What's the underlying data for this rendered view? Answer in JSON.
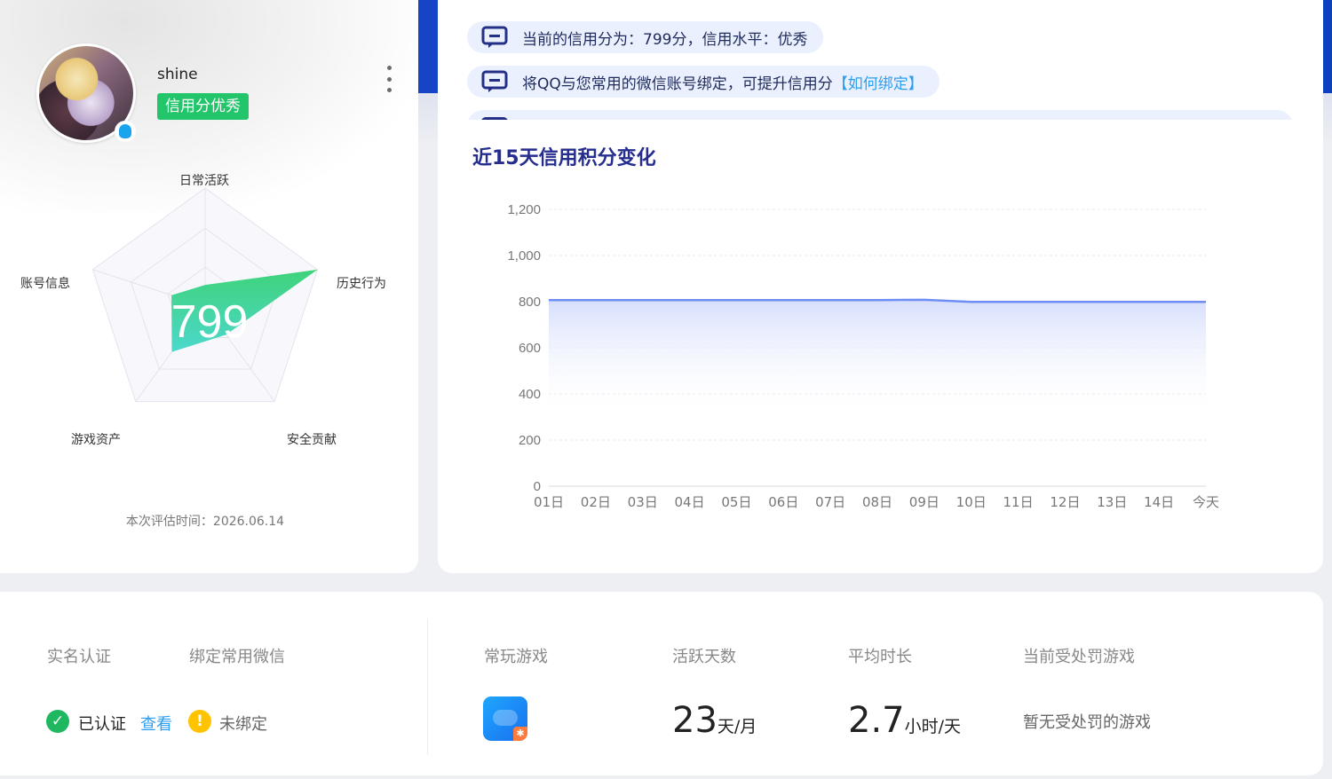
{
  "profile": {
    "username": "shine",
    "credit_tag": "信用分优秀",
    "score": "799",
    "eval_time": "本次评估时间：2026.06.14",
    "radar_labels": {
      "daily": "日常活跃",
      "history": "历史行为",
      "security": "安全贡献",
      "assets": "游戏资产",
      "account": "账号信息"
    },
    "radar_values": {
      "daily": 0.18,
      "history": 1.0,
      "security": 0.3,
      "assets": 0.48,
      "account": 0.3
    }
  },
  "notices": [
    {
      "text": "当前的信用分为：799分，信用水平：优秀"
    },
    {
      "text": "将QQ与您常用的微信账号绑定，可提升信用分",
      "link": "【如何绑定】"
    }
  ],
  "chart_title": "近15天信用积分变化",
  "chart_data": {
    "type": "area",
    "title": "近15天信用积分变化",
    "categories": [
      "01日",
      "02日",
      "03日",
      "04日",
      "05日",
      "06日",
      "07日",
      "08日",
      "09日",
      "10日",
      "11日",
      "12日",
      "13日",
      "14日",
      "今天"
    ],
    "series": [
      {
        "values": [
          807,
          807,
          807,
          807,
          807,
          807,
          807,
          807,
          808,
          799,
          799,
          799,
          799,
          799,
          799
        ]
      }
    ],
    "yticks": [
      "0",
      "200",
      "400",
      "600",
      "800",
      "1,000",
      "1,200"
    ],
    "ylim": [
      0,
      1200
    ],
    "grid": true,
    "color": "#6f8ef5"
  },
  "stats": {
    "realname_head": "实名认证",
    "wechat_head": "绑定常用微信",
    "verified_text": "已认证",
    "view_link": "查看",
    "unbound_text": "未绑定",
    "games_head": "常玩游戏",
    "active_head": "活跃天数",
    "active_value": "23",
    "active_unit": "天/月",
    "avg_head": "平均时长",
    "avg_value": "2.7",
    "avg_unit": "小时/天",
    "penalty_head": "当前受处罚游戏",
    "penalty_text": "暂无受处罚的游戏"
  }
}
